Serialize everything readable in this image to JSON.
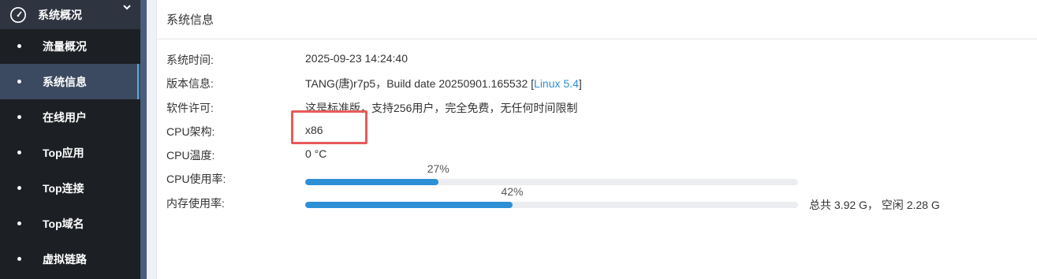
{
  "sidebar": {
    "header_label": "系统概况",
    "header_icon": "gauge-icon",
    "items": [
      {
        "label": "流量概况"
      },
      {
        "label": "系统信息"
      },
      {
        "label": "在线用户"
      },
      {
        "label": "Top应用"
      },
      {
        "label": "Top连接"
      },
      {
        "label": "Top域名"
      },
      {
        "label": "虚拟链路"
      }
    ],
    "active_index": 1
  },
  "panel": {
    "title": "系统信息",
    "rows": {
      "time": {
        "key": "系统时间:",
        "value": "2025-09-23 14:24:40"
      },
      "version": {
        "key": "版本信息:",
        "value_prefix": "TANG(唐)r7p5，Build date 20250901.165532 [",
        "link": "Linux 5.4",
        "value_suffix": "]"
      },
      "license": {
        "key": "软件许可:",
        "value": "这是标准版，支持256用户，完全免费，无任何时间限制"
      },
      "arch": {
        "key": "CPU架构:",
        "value": "x86"
      },
      "temp": {
        "key": "CPU温度:",
        "value": "0 °C"
      },
      "cpu": {
        "key": "CPU使用率:",
        "percent_label": "27%",
        "percent": 27
      },
      "mem": {
        "key": "内存使用率:",
        "percent_label": "42%",
        "percent": 42,
        "extra": "总共 3.92 G， 空闲 2.28 G"
      }
    }
  },
  "colors": {
    "accent": "#2d8fd5",
    "highlight": "#e85a5a",
    "sidebar_bg": "#1c1f24",
    "active_bg": "#3b4a60"
  }
}
